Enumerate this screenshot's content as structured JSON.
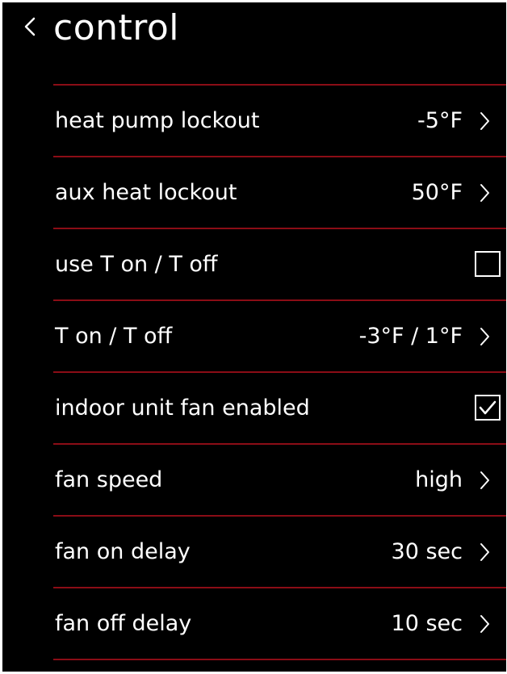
{
  "header": {
    "title": "control",
    "back_icon": "chevron-left-icon"
  },
  "colors": {
    "background": "#000000",
    "text": "#ffffff",
    "divider": "#8b0d16"
  },
  "rows": [
    {
      "label": "heat pump lockout",
      "value": "-5°F",
      "control": "chevron-right-icon"
    },
    {
      "label": "aux heat lockout",
      "value": "50°F",
      "control": "chevron-right-icon"
    },
    {
      "label": "use T on / T off",
      "control": "checkbox",
      "checked": false
    },
    {
      "label": "T on / T off",
      "value": "-3°F / 1°F",
      "control": "chevron-right-icon"
    },
    {
      "label": "indoor unit fan enabled",
      "control": "checkbox",
      "checked": true
    },
    {
      "label": "fan speed",
      "value": "high",
      "control": "chevron-right-icon"
    },
    {
      "label": "fan on delay",
      "value": "30 sec",
      "control": "chevron-right-icon"
    },
    {
      "label": "fan off delay",
      "value": "10 sec",
      "control": "chevron-right-icon"
    }
  ]
}
